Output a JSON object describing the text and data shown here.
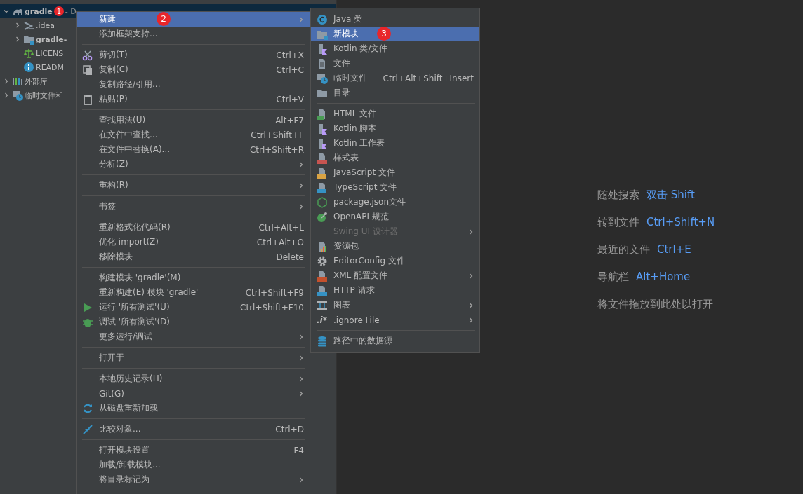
{
  "project_tree": {
    "items": [
      {
        "label": "gradle",
        "path": "- D",
        "expanded": true,
        "selected": true,
        "badge": "1",
        "children": [
          {
            "label": ".idea",
            "expanded": false,
            "selected": false
          },
          {
            "label": "gradle-",
            "expanded": false,
            "selected": false
          },
          {
            "label": "LICENS",
            "selected": false
          },
          {
            "label": "READM",
            "selected": false
          }
        ]
      },
      {
        "label": "外部库",
        "expanded": false,
        "selected": false
      },
      {
        "label": "临时文件和",
        "expanded": false,
        "selected": false
      }
    ]
  },
  "context_menu": {
    "items": [
      {
        "kind": "item",
        "label": "新建",
        "submenu": true,
        "selected": true,
        "badge": "2"
      },
      {
        "kind": "item",
        "label": "添加框架支持...",
        "selected": false
      },
      {
        "kind": "separator"
      },
      {
        "kind": "item",
        "label": "剪切(T)",
        "shortcut": "Ctrl+X",
        "selected": false
      },
      {
        "kind": "item",
        "label": "复制(C)",
        "shortcut": "Ctrl+C",
        "selected": false
      },
      {
        "kind": "item",
        "label": "复制路径/引用...",
        "selected": false
      },
      {
        "kind": "item",
        "label": "粘贴(P)",
        "shortcut": "Ctrl+V",
        "selected": false
      },
      {
        "kind": "separator"
      },
      {
        "kind": "item",
        "label": "查找用法(U)",
        "shortcut": "Alt+F7",
        "selected": false
      },
      {
        "kind": "item",
        "label": "在文件中查找...",
        "shortcut": "Ctrl+Shift+F",
        "selected": false
      },
      {
        "kind": "item",
        "label": "在文件中替换(A)...",
        "shortcut": "Ctrl+Shift+R",
        "selected": false
      },
      {
        "kind": "item",
        "label": "分析(Z)",
        "submenu": true,
        "selected": false
      },
      {
        "kind": "separator"
      },
      {
        "kind": "item",
        "label": "重构(R)",
        "submenu": true,
        "selected": false
      },
      {
        "kind": "separator"
      },
      {
        "kind": "item",
        "label": "书签",
        "submenu": true,
        "selected": false
      },
      {
        "kind": "separator"
      },
      {
        "kind": "item",
        "label": "重新格式化代码(R)",
        "shortcut": "Ctrl+Alt+L",
        "selected": false
      },
      {
        "kind": "item",
        "label": "优化 import(Z)",
        "shortcut": "Ctrl+Alt+O",
        "selected": false
      },
      {
        "kind": "item",
        "label": "移除模块",
        "shortcut": "Delete",
        "selected": false
      },
      {
        "kind": "separator"
      },
      {
        "kind": "item",
        "label": "构建模块 'gradle'(M)",
        "selected": false
      },
      {
        "kind": "item",
        "label": "重新构建(E) 模块 'gradle'",
        "shortcut": "Ctrl+Shift+F9",
        "selected": false
      },
      {
        "kind": "item",
        "label": "运行 '所有测试'(U)",
        "shortcut": "Ctrl+Shift+F10",
        "selected": false
      },
      {
        "kind": "item",
        "label": "调试 '所有测试'(D)",
        "selected": false
      },
      {
        "kind": "item",
        "label": "更多运行/调试",
        "submenu": true,
        "selected": false
      },
      {
        "kind": "separator"
      },
      {
        "kind": "item",
        "label": "打开于",
        "submenu": true,
        "selected": false
      },
      {
        "kind": "separator"
      },
      {
        "kind": "item",
        "label": "本地历史记录(H)",
        "submenu": true,
        "selected": false
      },
      {
        "kind": "item",
        "label": "Git(G)",
        "submenu": true,
        "selected": false
      },
      {
        "kind": "item",
        "label": "从磁盘重新加载",
        "selected": false
      },
      {
        "kind": "separator"
      },
      {
        "kind": "item",
        "label": "比较对象...",
        "shortcut": "Ctrl+D",
        "selected": false
      },
      {
        "kind": "separator"
      },
      {
        "kind": "item",
        "label": "打开模块设置",
        "shortcut": "F4",
        "selected": false
      },
      {
        "kind": "item",
        "label": "加载/卸载模块...",
        "selected": false
      },
      {
        "kind": "item",
        "label": "将目录标记为",
        "submenu": true,
        "selected": false
      },
      {
        "kind": "separator"
      }
    ]
  },
  "new_submenu": {
    "items": [
      {
        "kind": "item",
        "label": "Java 类",
        "selected": false
      },
      {
        "kind": "item",
        "label": "新模块",
        "selected": true,
        "badge": "3"
      },
      {
        "kind": "item",
        "label": "Kotlin 类/文件",
        "selected": false
      },
      {
        "kind": "item",
        "label": "文件",
        "selected": false
      },
      {
        "kind": "item",
        "label": "临时文件",
        "shortcut": "Ctrl+Alt+Shift+Insert",
        "selected": false
      },
      {
        "kind": "item",
        "label": "目录",
        "selected": false
      },
      {
        "kind": "separator"
      },
      {
        "kind": "item",
        "label": "HTML 文件",
        "selected": false
      },
      {
        "kind": "item",
        "label": "Kotlin 脚本",
        "selected": false
      },
      {
        "kind": "item",
        "label": "Kotlin 工作表",
        "selected": false
      },
      {
        "kind": "item",
        "label": "样式表",
        "selected": false
      },
      {
        "kind": "item",
        "label": "JavaScript 文件",
        "selected": false
      },
      {
        "kind": "item",
        "label": "TypeScript 文件",
        "selected": false
      },
      {
        "kind": "item",
        "label": "package.json文件",
        "selected": false
      },
      {
        "kind": "item",
        "label": "OpenAPI 规范",
        "selected": false
      },
      {
        "kind": "item",
        "label": "Swing UI 设计器",
        "submenu": true,
        "disabled": true,
        "selected": false
      },
      {
        "kind": "item",
        "label": "资源包",
        "selected": false
      },
      {
        "kind": "item",
        "label": "EditorConfig 文件",
        "selected": false
      },
      {
        "kind": "item",
        "label": "XML 配置文件",
        "submenu": true,
        "selected": false
      },
      {
        "kind": "item",
        "label": "HTTP 请求",
        "selected": false
      },
      {
        "kind": "item",
        "label": "图表",
        "submenu": true,
        "selected": false
      },
      {
        "kind": "item",
        "label": ".ignore File",
        "icon_text": ".i*",
        "submenu": true,
        "selected": false
      },
      {
        "kind": "separator"
      },
      {
        "kind": "item",
        "label": "路径中的数据源",
        "selected": false
      }
    ]
  },
  "editor_hints": [
    {
      "label": "随处搜索",
      "shortcut": "双击 Shift"
    },
    {
      "label": "转到文件",
      "shortcut": "Ctrl+Shift+N"
    },
    {
      "label": "最近的文件",
      "shortcut": "Ctrl+E"
    },
    {
      "label": "导航栏",
      "shortcut": "Alt+Home"
    },
    {
      "label": "将文件拖放到此处以打开"
    }
  ]
}
